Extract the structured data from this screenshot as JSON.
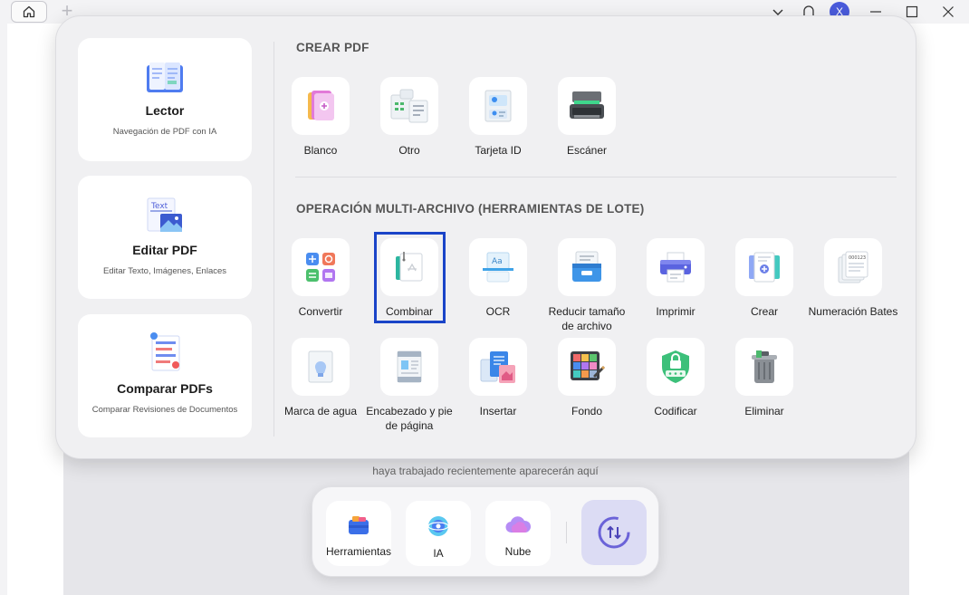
{
  "window": {
    "home_icon": "home-icon",
    "new_tab_icon": "plus-icon",
    "avatar_initial": "X"
  },
  "background": {
    "recent_text": "haya trabajado recientemente aparecerán aquí"
  },
  "left_cards": [
    {
      "title": "Lector",
      "subtitle": "Navegación de PDF con IA",
      "icon": "reader-book-icon"
    },
    {
      "title": "Editar PDF",
      "subtitle": "Editar Texto, Imágenes, Enlaces",
      "icon": "edit-text-image-icon"
    },
    {
      "title": "Comparar PDFs",
      "subtitle": "Comparar Revisiones de Documentos",
      "icon": "compare-documents-icon"
    }
  ],
  "create_section": {
    "title": "CREAR PDF",
    "items": [
      {
        "label": "Blanco",
        "icon": "blank-pdf-icon"
      },
      {
        "label": "Otro",
        "icon": "other-files-icon"
      },
      {
        "label": "Tarjeta ID",
        "icon": "id-card-icon"
      },
      {
        "label": "Escáner",
        "icon": "scanner-icon"
      }
    ]
  },
  "batch_section": {
    "title": "OPERACIÓN MULTI-ARCHIVO (HERRAMIENTAS DE LOTE)",
    "row1": [
      {
        "label": "Convertir",
        "icon": "convert-icon"
      },
      {
        "label": "Combinar",
        "icon": "combine-icon",
        "selected": true
      },
      {
        "label": "OCR",
        "icon": "ocr-icon"
      },
      {
        "label": "Reducir tamaño de archivo",
        "icon": "compress-icon"
      },
      {
        "label": "Imprimir",
        "icon": "printer-icon"
      },
      {
        "label": "Crear",
        "icon": "create-pdf-icon"
      },
      {
        "label": "Numeración Bates",
        "icon": "bates-numbering-icon"
      }
    ],
    "row2": [
      {
        "label": "Marca de agua",
        "icon": "watermark-icon"
      },
      {
        "label": "Encabezado y pie de página",
        "icon": "header-footer-icon"
      },
      {
        "label": "Insertar",
        "icon": "insert-pages-icon"
      },
      {
        "label": "Fondo",
        "icon": "background-icon"
      },
      {
        "label": "Codificar",
        "icon": "encrypt-shield-icon"
      },
      {
        "label": "Eliminar",
        "icon": "trash-icon"
      }
    ]
  },
  "dock": {
    "items": [
      {
        "label": "Herramientas",
        "icon": "tools-icon"
      },
      {
        "label": "IA",
        "icon": "ai-icon"
      },
      {
        "label": "Nube",
        "icon": "cloud-icon"
      }
    ],
    "toggle_icon": "switch-arrows-icon"
  },
  "colors": {
    "accent": "#1a44c8",
    "avatar": "#4a5bdb",
    "panel": "#f0f0f2"
  }
}
